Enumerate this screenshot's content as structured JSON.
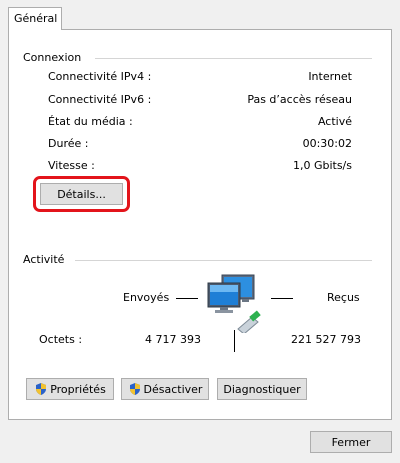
{
  "tabs": {
    "general": "Général"
  },
  "connection": {
    "title": "Connexion",
    "rows": [
      {
        "label": "Connectivité IPv4 :",
        "value": "Internet"
      },
      {
        "label": "Connectivité IPv6 :",
        "value": "Pas d’accès réseau"
      },
      {
        "label": "État du média :",
        "value": "Activé"
      },
      {
        "label": "Durée :",
        "value": "00:30:02"
      },
      {
        "label": "Vitesse :",
        "value": "1,0 Gbits/s"
      }
    ],
    "details_button": "Détails..."
  },
  "activity": {
    "title": "Activité",
    "sent_label": "Envoyés",
    "received_label": "Reçus",
    "bytes_label": "Octets :",
    "bytes_sent": "4 717 393",
    "bytes_received": "221 527 793"
  },
  "buttons": {
    "properties": "Propriétés",
    "disable": "Désactiver",
    "diagnose": "Diagnostiquer",
    "close": "Fermer"
  },
  "icons": {
    "network": "network-computers-icon",
    "shield": "uac-shield-icon"
  },
  "colors": {
    "highlight_border": "#e3141b",
    "panel_bg": "#ffffff",
    "window_bg": "#f0f0f0"
  }
}
